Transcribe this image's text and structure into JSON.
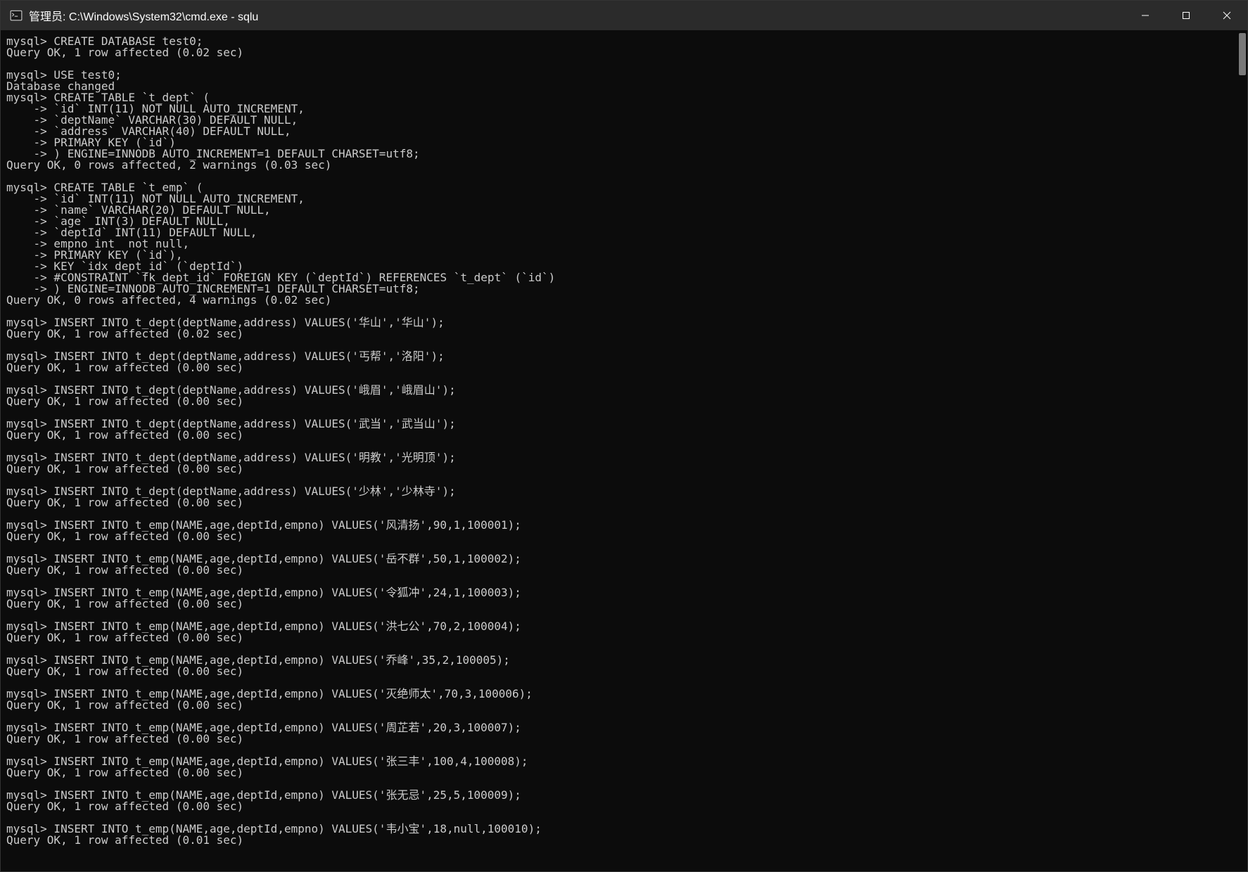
{
  "window": {
    "title": "管理员: C:\\Windows\\System32\\cmd.exe - sqlu"
  },
  "lines": [
    "mysql> CREATE DATABASE test0;",
    "Query OK, 1 row affected (0.02 sec)",
    "",
    "mysql> USE test0;",
    "Database changed",
    "mysql> CREATE TABLE `t_dept` (",
    "    -> `id` INT(11) NOT NULL AUTO_INCREMENT,",
    "    -> `deptName` VARCHAR(30) DEFAULT NULL,",
    "    -> `address` VARCHAR(40) DEFAULT NULL,",
    "    -> PRIMARY KEY (`id`)",
    "    -> ) ENGINE=INNODB AUTO_INCREMENT=1 DEFAULT CHARSET=utf8;",
    "Query OK, 0 rows affected, 2 warnings (0.03 sec)",
    "",
    "mysql> CREATE TABLE `t_emp` (",
    "    -> `id` INT(11) NOT NULL AUTO_INCREMENT,",
    "    -> `name` VARCHAR(20) DEFAULT NULL,",
    "    -> `age` INT(3) DEFAULT NULL,",
    "    -> `deptId` INT(11) DEFAULT NULL,",
    "    -> empno int  not null,",
    "    -> PRIMARY KEY (`id`),",
    "    -> KEY `idx_dept_id` (`deptId`)",
    "    -> #CONSTRAINT `fk_dept_id` FOREIGN KEY (`deptId`) REFERENCES `t_dept` (`id`)",
    "    -> ) ENGINE=INNODB AUTO_INCREMENT=1 DEFAULT CHARSET=utf8;",
    "Query OK, 0 rows affected, 4 warnings (0.02 sec)",
    "",
    "mysql> INSERT INTO t_dept(deptName,address) VALUES('华山','华山');",
    "Query OK, 1 row affected (0.02 sec)",
    "",
    "mysql> INSERT INTO t_dept(deptName,address) VALUES('丐帮','洛阳');",
    "Query OK, 1 row affected (0.00 sec)",
    "",
    "mysql> INSERT INTO t_dept(deptName,address) VALUES('峨眉','峨眉山');",
    "Query OK, 1 row affected (0.00 sec)",
    "",
    "mysql> INSERT INTO t_dept(deptName,address) VALUES('武当','武当山');",
    "Query OK, 1 row affected (0.00 sec)",
    "",
    "mysql> INSERT INTO t_dept(deptName,address) VALUES('明教','光明顶');",
    "Query OK, 1 row affected (0.00 sec)",
    "",
    "mysql> INSERT INTO t_dept(deptName,address) VALUES('少林','少林寺');",
    "Query OK, 1 row affected (0.00 sec)",
    "",
    "mysql> INSERT INTO t_emp(NAME,age,deptId,empno) VALUES('风清扬',90,1,100001);",
    "Query OK, 1 row affected (0.00 sec)",
    "",
    "mysql> INSERT INTO t_emp(NAME,age,deptId,empno) VALUES('岳不群',50,1,100002);",
    "Query OK, 1 row affected (0.00 sec)",
    "",
    "mysql> INSERT INTO t_emp(NAME,age,deptId,empno) VALUES('令狐冲',24,1,100003);",
    "Query OK, 1 row affected (0.00 sec)",
    "",
    "mysql> INSERT INTO t_emp(NAME,age,deptId,empno) VALUES('洪七公',70,2,100004);",
    "Query OK, 1 row affected (0.00 sec)",
    "",
    "mysql> INSERT INTO t_emp(NAME,age,deptId,empno) VALUES('乔峰',35,2,100005);",
    "Query OK, 1 row affected (0.00 sec)",
    "",
    "mysql> INSERT INTO t_emp(NAME,age,deptId,empno) VALUES('灭绝师太',70,3,100006);",
    "Query OK, 1 row affected (0.00 sec)",
    "",
    "mysql> INSERT INTO t_emp(NAME,age,deptId,empno) VALUES('周芷若',20,3,100007);",
    "Query OK, 1 row affected (0.00 sec)",
    "",
    "mysql> INSERT INTO t_emp(NAME,age,deptId,empno) VALUES('张三丰',100,4,100008);",
    "Query OK, 1 row affected (0.00 sec)",
    "",
    "mysql> INSERT INTO t_emp(NAME,age,deptId,empno) VALUES('张无忌',25,5,100009);",
    "Query OK, 1 row affected (0.00 sec)",
    "",
    "mysql> INSERT INTO t_emp(NAME,age,deptId,empno) VALUES('韦小宝',18,null,100010);",
    "Query OK, 1 row affected (0.01 sec)",
    ""
  ]
}
